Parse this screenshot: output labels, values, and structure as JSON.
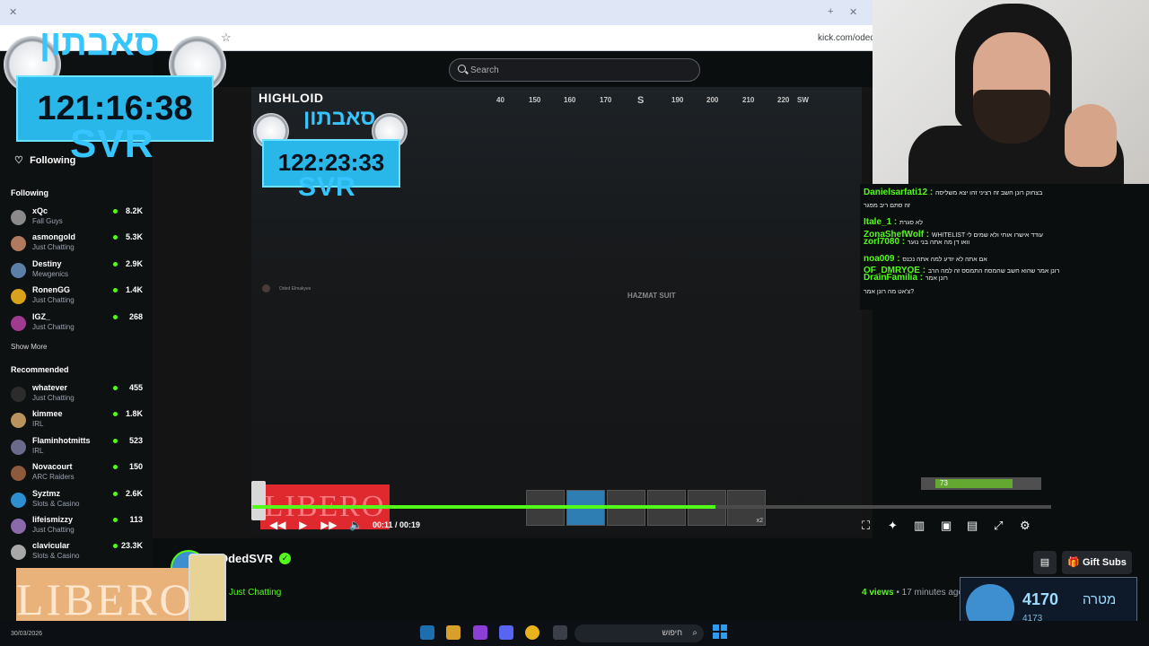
{
  "browser": {
    "url": "kick.com/oded"
  },
  "header": {
    "search_placeholder": "Search"
  },
  "sidebar": {
    "following_label": "Following",
    "following_section_title": "Following",
    "following": [
      {
        "name": "xQc",
        "category": "Fall Guys",
        "viewers": "8.2K",
        "avatar_color": "#8a8a8a"
      },
      {
        "name": "asmongold",
        "category": "Just Chatting",
        "viewers": "5.3K",
        "avatar_color": "#b07a5e"
      },
      {
        "name": "Destiny",
        "category": "Mewgenics",
        "viewers": "2.9K",
        "avatar_color": "#5c7fa6"
      },
      {
        "name": "RonenGG",
        "category": "Just Chatting",
        "viewers": "1.4K",
        "avatar_color": "#d9a21c"
      },
      {
        "name": "IGZ_",
        "category": "Just Chatting",
        "viewers": "268",
        "avatar_color": "#a03a8f"
      }
    ],
    "show_more_label": "Show More",
    "recommended_section_title": "Recommended",
    "recommended": [
      {
        "name": "whatever",
        "category": "Just Chatting",
        "viewers": "455",
        "avatar_color": "#2c2c2c"
      },
      {
        "name": "kimmee",
        "category": "IRL",
        "viewers": "1.8K",
        "avatar_color": "#b8935e"
      },
      {
        "name": "Flaminhotmitts",
        "category": "IRL",
        "viewers": "523",
        "avatar_color": "#6a6a8a"
      },
      {
        "name": "Novacourt",
        "category": "ARC Raiders",
        "viewers": "150",
        "avatar_color": "#8e5a3c"
      },
      {
        "name": "Syztmz",
        "category": "Slots & Casino",
        "viewers": "2.6K",
        "avatar_color": "#2d8fcf"
      },
      {
        "name": "lifeismizzy",
        "category": "Just Chatting",
        "viewers": "113",
        "avatar_color": "#8a6aa8"
      },
      {
        "name": "clavicular",
        "category": "Slots & Casino",
        "viewers": "23.3K",
        "avatar_color": "#a8a8a8"
      }
    ]
  },
  "overlay": {
    "timer_big": "121:16:38",
    "timer_small": "122:23:33",
    "svr_label": "SVR",
    "heb_title": "סאבתון",
    "game_title": "HIGHLOID"
  },
  "game": {
    "compass": [
      "40",
      "150",
      "160",
      "170",
      "S",
      "190",
      "200",
      "210",
      "220",
      "SW"
    ],
    "hazmat_label": "HAZMAT SUIT",
    "feed": [
      "Oded Elmakyes"
    ],
    "health_value": "73",
    "health_fraction": 0.73,
    "hotbar_count": "x2"
  },
  "player": {
    "current_time": "00:11",
    "duration": "00:19",
    "progress_fraction": 0.58
  },
  "stream": {
    "streamer_name": "OdedSVR",
    "category": "Just Chatting",
    "views_count": "4 views",
    "views_time": "17 minutes ago",
    "gift_subs_label": "Gift Subs"
  },
  "chat": [
    {
      "user": "Danielsarfati12",
      "text": "בצחוק רונן חשב זה רציני זהו יצא משליסה"
    },
    {
      "user": "",
      "text": "זה סתם ריב מפגר"
    },
    {
      "user": "Itale_1",
      "text": "לא סגרת"
    },
    {
      "user": "ZonaShefWolf",
      "text": "WHITELIST עודד אישרו אותי ולא שמים לי"
    },
    {
      "user": "zorl7080",
      "text": "וואו דן מה אתה בני נוער"
    },
    {
      "user": "noa009",
      "text": "אם אתה לא יודע למה אתה נכנס"
    },
    {
      "user": "OF_DMRYOE",
      "text": "רונן אמר שהוא חשב שהמסח התמסס זה למה הרב"
    },
    {
      "user": "DrainFamilia",
      "text": "רונן אמר"
    },
    {
      "user": "",
      "text": "צ'אט מה רונן אמר?"
    }
  ],
  "goal": {
    "current": "4170",
    "label": "מטרה",
    "sub": "4173"
  },
  "ads": {
    "brand": "LIBERO"
  },
  "taskbar": {
    "date": "30/03/2026",
    "search_placeholder": "חיפוש"
  },
  "colors": {
    "kick_green": "#53fc18",
    "timer_blue": "#29b6e8"
  }
}
